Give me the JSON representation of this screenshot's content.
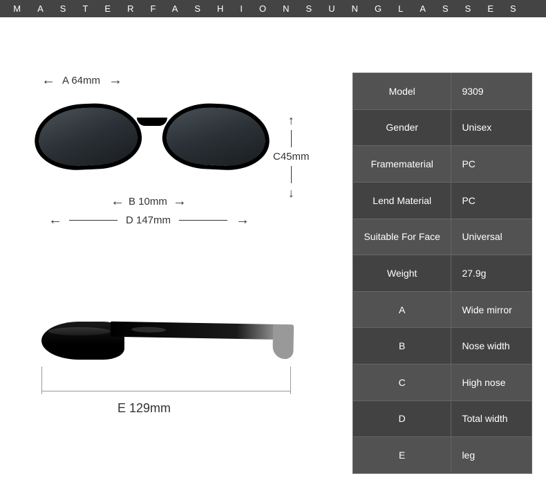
{
  "header": {
    "title": "MASTERFASHIONSUNGLASSES"
  },
  "dimensions": {
    "a": "A 64mm",
    "b": "B 10mm",
    "c": "C45mm",
    "d": "D 147mm",
    "e": "E 129mm"
  },
  "specs": [
    {
      "label": "Model",
      "value": "9309"
    },
    {
      "label": "Gender",
      "value": "Unisex"
    },
    {
      "label": "Framematerial",
      "value": "PC"
    },
    {
      "label": "Lend Material",
      "value": "PC"
    },
    {
      "label": "Suitable For Face",
      "value": "Universal"
    },
    {
      "label": "Weight",
      "value": "27.9g"
    },
    {
      "label": "A",
      "value": "Wide mirror"
    },
    {
      "label": "B",
      "value": "Nose width"
    },
    {
      "label": "C",
      "value": "High nose"
    },
    {
      "label": "D",
      "value": "Total width"
    },
    {
      "label": "E",
      "value": "leg"
    }
  ]
}
